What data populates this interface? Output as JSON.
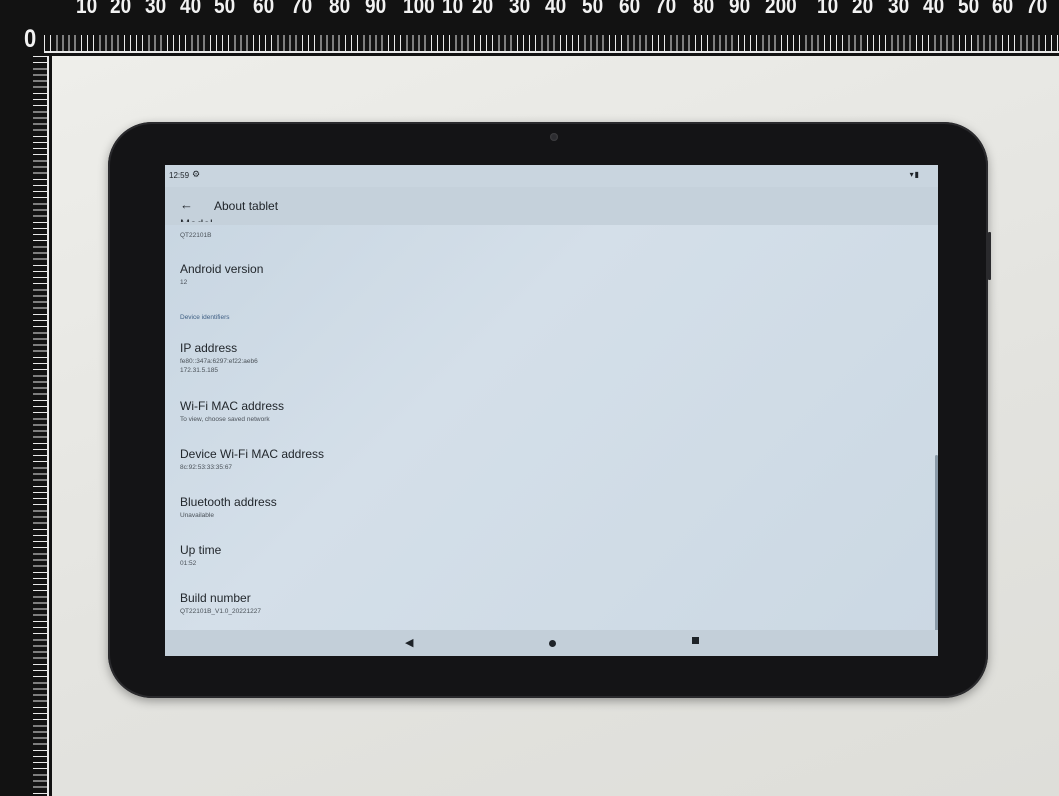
{
  "ruler": {
    "top_labels": [
      "0",
      "10",
      "20",
      "30",
      "40",
      "50",
      "60",
      "70",
      "80",
      "90",
      "100",
      "10",
      "20",
      "30",
      "40",
      "50",
      "60",
      "70",
      "80",
      "90",
      "200",
      "10",
      "20",
      "30",
      "40",
      "50",
      "60",
      "70"
    ]
  },
  "status_bar": {
    "time": "12:59",
    "settings_icon": "gear-icon",
    "right_icons": "wifi-icon battery-icon"
  },
  "app_bar": {
    "title": "About tablet",
    "back_icon": "arrow-left-icon"
  },
  "settings": {
    "partial_title": "Model",
    "model_value": "QT22101B",
    "android_version": {
      "title": "Android version",
      "value": "12"
    },
    "section_header": "Device identifiers",
    "ip_address": {
      "title": "IP address",
      "value_line1": "fe80::347a:6297:ef22:aeb6",
      "value_line2": "172.31.5.185"
    },
    "wifi_mac": {
      "title": "Wi-Fi MAC address",
      "value": "To view, choose saved network"
    },
    "device_wifi_mac": {
      "title": "Device Wi-Fi MAC address",
      "value": "8c:92:53:33:35:67"
    },
    "bluetooth": {
      "title": "Bluetooth address",
      "value": "Unavailable"
    },
    "up_time": {
      "title": "Up time",
      "value": "01:52"
    },
    "build_number": {
      "title": "Build number",
      "value": "QT22101B_V1.0_20221227"
    }
  },
  "nav_bar": {
    "back_glyph": "◀",
    "colors": {
      "icons": "#1e2328"
    }
  },
  "colors": {
    "screen_bg": "#cfdbe5",
    "section_header": "#3f5f84",
    "bezel": "#141416"
  }
}
